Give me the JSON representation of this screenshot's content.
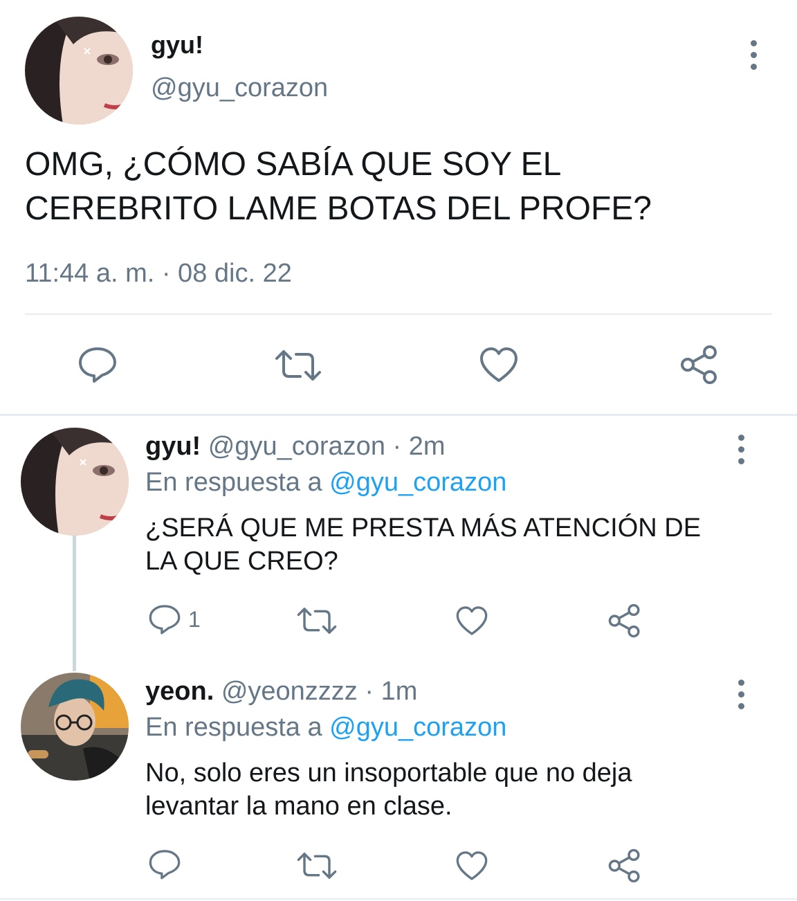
{
  "main_tweet": {
    "display_name": "gyu!",
    "handle": "@gyu_corazon",
    "text_line1": "OMG, ¿CÓMO SABÍA QUE SOY EL",
    "text_line2": "CEREBRITO LAME BOTAS DEL PROFE?",
    "timestamp": "11:44 a. m. · 08 dic. 22",
    "avatar": "profile-photo-gyu"
  },
  "replies": [
    {
      "display_name": "gyu!",
      "handle": "@gyu_corazon",
      "time": "· 2m",
      "reply_prefix": "En respuesta a",
      "reply_to": "@gyu_corazon",
      "text_line1": "¿SERÁ QUE ME PRESTA MÁS ATENCIÓN DE",
      "text_line2": "LA QUE CREO?",
      "reply_count": "1",
      "avatar": "profile-photo-gyu"
    },
    {
      "display_name": "yeon.",
      "handle": "@yeonzzzz",
      "time": "· 1m",
      "reply_prefix": "En respuesta a",
      "reply_to": "@gyu_corazon",
      "text_line1": "No, solo eres un insoportable que no deja",
      "text_line2": "levantar la mano en clase.",
      "reply_count": "",
      "avatar": "profile-photo-yeon"
    }
  ],
  "icons": {
    "reply": "speech-bubble-icon",
    "retweet": "retweet-arrows-icon",
    "like": "heart-icon",
    "share": "share-nodes-icon",
    "more": "vertical-dots-icon"
  },
  "colors": {
    "text": "#14171a",
    "secondary": "#657786",
    "link": "#1da1f2",
    "divider": "#e6ecf0"
  }
}
